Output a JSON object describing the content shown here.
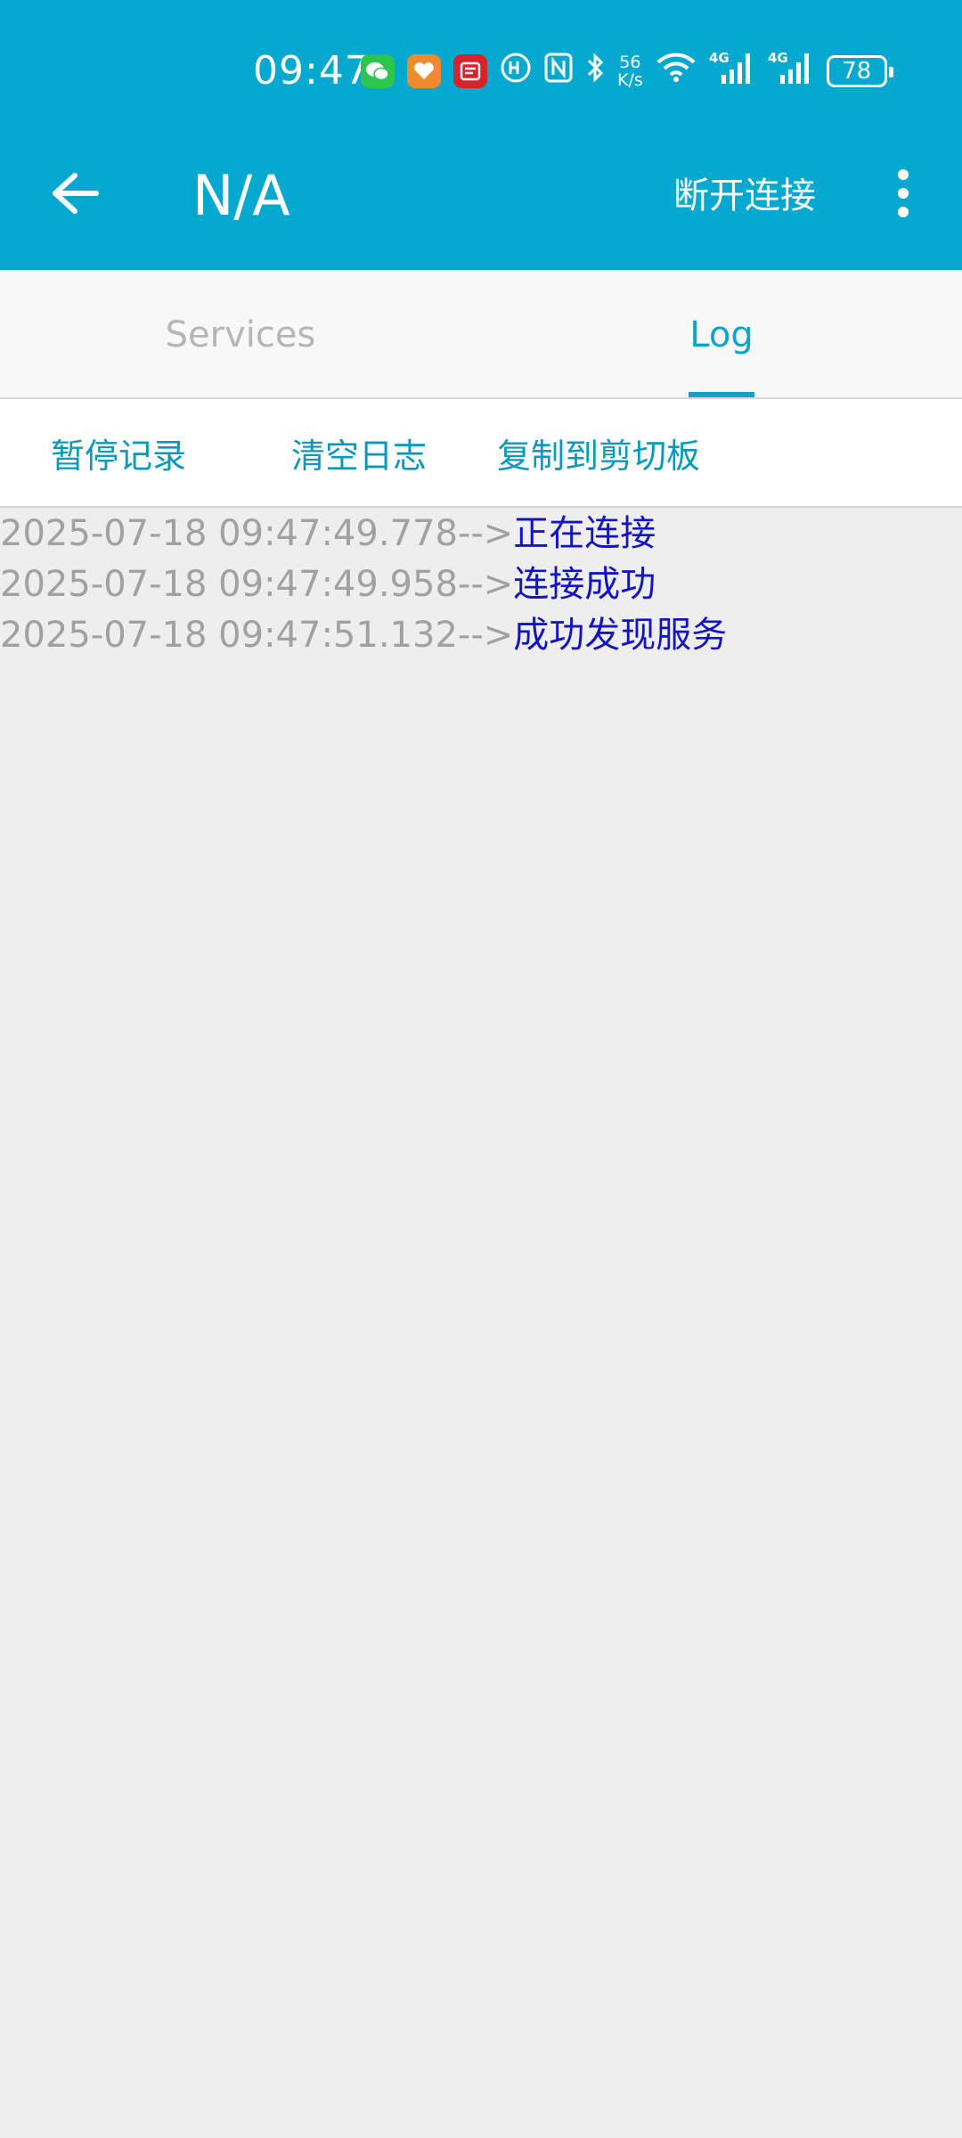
{
  "status_bar": {
    "time": "09:47",
    "net_speed_value": "56",
    "net_speed_unit": "K/s",
    "sim1_label": "4G",
    "sim2_label": "4G",
    "battery": "78"
  },
  "app_bar": {
    "title": "N/A",
    "disconnect_label": "断开连接"
  },
  "tabs": [
    {
      "label": "Services",
      "selected": false
    },
    {
      "label": "Log",
      "selected": true
    }
  ],
  "actions": {
    "pause": "暂停记录",
    "clear": "清空日志",
    "copy": "复制到剪切板"
  },
  "log": [
    {
      "timestamp": "2025-07-18 09:47:49.778-->",
      "message": "正在连接"
    },
    {
      "timestamp": "2025-07-18 09:47:49.958-->",
      "message": "连接成功"
    },
    {
      "timestamp": "2025-07-18 09:47:51.132-->",
      "message": "成功发现服务"
    }
  ],
  "colors": {
    "primary": "#05a8ce",
    "accent": "#0fa3c4",
    "log_message": "#1414c4",
    "log_timestamp": "#a3a0a0"
  },
  "icons": [
    "wechat-icon",
    "health-app-icon",
    "news-app-icon",
    "hd-icon",
    "nfc-icon",
    "bluetooth-icon",
    "wifi-icon",
    "signal-icon",
    "battery-icon",
    "back-arrow-icon",
    "more-vert-icon"
  ]
}
